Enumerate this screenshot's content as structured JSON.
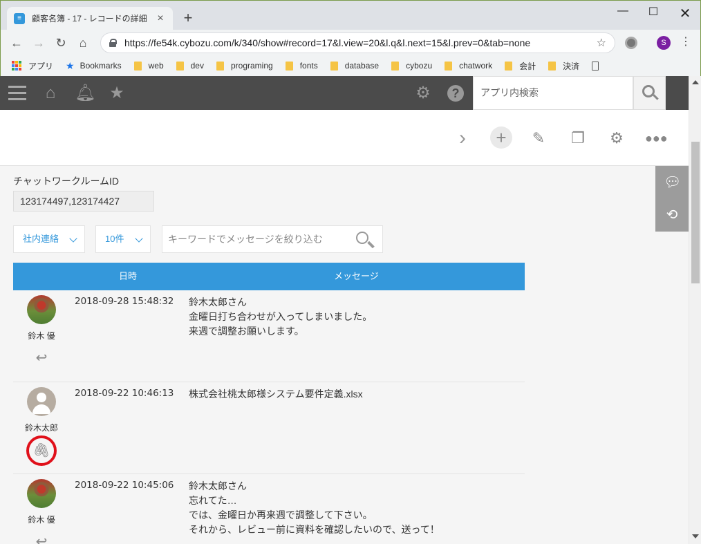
{
  "browser": {
    "tab_title": "顧客名簿 - 17 - レコードの詳細",
    "tab_close": "×",
    "new_tab": "+",
    "url": "https://fe54k.cybozu.com/k/340/show#record=17&l.view=20&l.q&l.next=15&l.prev=0&tab=none",
    "profile_initial": "S",
    "bookmarks": [
      {
        "label": "アプリ",
        "icon": "apps-grid-icon"
      },
      {
        "label": "Bookmarks",
        "icon": "star-icon"
      },
      {
        "label": "web",
        "icon": "folder-icon"
      },
      {
        "label": "dev",
        "icon": "folder-icon"
      },
      {
        "label": "programing",
        "icon": "folder-icon"
      },
      {
        "label": "fonts",
        "icon": "folder-icon"
      },
      {
        "label": "database",
        "icon": "folder-icon"
      },
      {
        "label": "cybozu",
        "icon": "folder-icon"
      },
      {
        "label": "chatwork",
        "icon": "folder-icon"
      },
      {
        "label": "会計",
        "icon": "folder-icon"
      },
      {
        "label": "決済",
        "icon": "folder-icon"
      }
    ]
  },
  "kintone": {
    "search_placeholder": "アプリ内検索"
  },
  "record": {
    "field_label": "チャットワークルームID",
    "field_value": "123174497,123174427"
  },
  "filters": {
    "room_select": "社内連絡",
    "count_select": "10件",
    "keyword_placeholder": "キーワードでメッセージを絞り込む"
  },
  "table": {
    "col_datetime": "日時",
    "col_message": "メッセージ"
  },
  "messages": [
    {
      "user": "鈴木 優",
      "datetime": "2018-09-28 15:48:32",
      "lines": [
        "鈴木太郎さん",
        "金曜日打ち合わせが入ってしまいました。",
        "来週で調整お願いします。"
      ]
    },
    {
      "user": "鈴木太郎",
      "datetime": "2018-09-22 10:46:13",
      "lines": [
        "株式会社桃太郎様システム要件定義.xlsx"
      ]
    },
    {
      "user": "鈴木 優",
      "datetime": "2018-09-22 10:45:06",
      "lines": [
        "鈴木太郎さん",
        "忘れてた…",
        "では、金曜日か再来週で調整して下さい。",
        "それから、レビュー前に資料を確認したいので、送って！"
      ]
    }
  ],
  "colors": {
    "accent": "#3498db",
    "header_bg": "#4b4b4b",
    "highlight_circle": "#e0101a"
  }
}
